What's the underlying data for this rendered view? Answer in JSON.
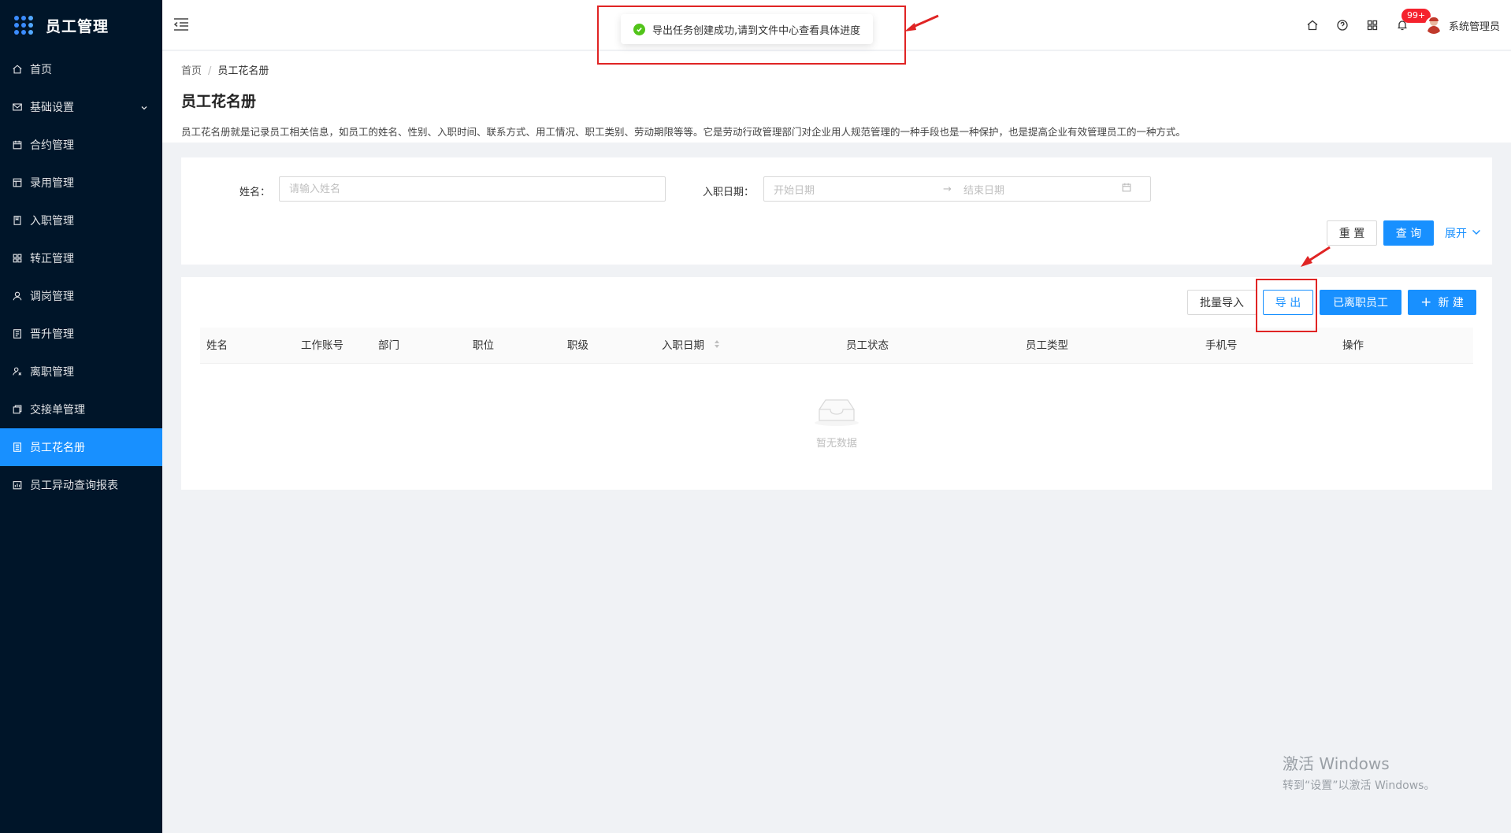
{
  "app": {
    "title": "员工管理"
  },
  "sidebar": {
    "items": [
      {
        "label": "首页",
        "icon": "home-icon"
      },
      {
        "label": "基础设置",
        "icon": "mail-icon",
        "expandable": true
      },
      {
        "label": "合约管理",
        "icon": "calendar-icon"
      },
      {
        "label": "录用管理",
        "icon": "table-icon"
      },
      {
        "label": "入职管理",
        "icon": "book-icon"
      },
      {
        "label": "转正管理",
        "icon": "grid-icon"
      },
      {
        "label": "调岗管理",
        "icon": "user-icon"
      },
      {
        "label": "晋升管理",
        "icon": "report-icon"
      },
      {
        "label": "离职管理",
        "icon": "leave-icon"
      },
      {
        "label": "交接单管理",
        "icon": "copy-icon"
      },
      {
        "label": "员工花名册",
        "icon": "roster-icon",
        "active": true
      },
      {
        "label": "员工异动查询报表",
        "icon": "chart-report-icon"
      }
    ]
  },
  "header": {
    "notification_count": "99+",
    "username": "系统管理员"
  },
  "toast": {
    "message": "导出任务创建成功,请到文件中心查看具体进度"
  },
  "breadcrumb": {
    "home": "首页",
    "current": "员工花名册"
  },
  "page": {
    "title": "员工花名册",
    "description": "员工花名册就是记录员工相关信息，如员工的姓名、性别、入职时间、联系方式、用工情况、职工类别、劳动期限等等。它是劳动行政管理部门对企业用人规范管理的一种手段也是一种保护，也是提高企业有效管理员工的一种方式。"
  },
  "search": {
    "name_label": "姓名：",
    "name_placeholder": "请输入姓名",
    "date_label": "入职日期：",
    "start_placeholder": "开始日期",
    "end_placeholder": "结束日期",
    "reset_label": "重 置",
    "query_label": "查 询",
    "expand_label": "展开"
  },
  "toolbar": {
    "import_label": "批量导入",
    "export_label": "导 出",
    "resigned_label": "已离职员工",
    "new_label": "新 建"
  },
  "table": {
    "columns": [
      "姓名",
      "工作账号",
      "部门",
      "职位",
      "职级",
      "入职日期",
      "员工状态",
      "员工类型",
      "手机号",
      "操作"
    ],
    "empty_text": "暂无数据"
  },
  "watermark": {
    "line1": "激活 Windows",
    "line2": "转到“设置”以激活 Windows。"
  },
  "colors": {
    "sidebar_bg": "#001529",
    "primary": "#1890ff",
    "success": "#52c41a",
    "annotation": "#e02424"
  }
}
